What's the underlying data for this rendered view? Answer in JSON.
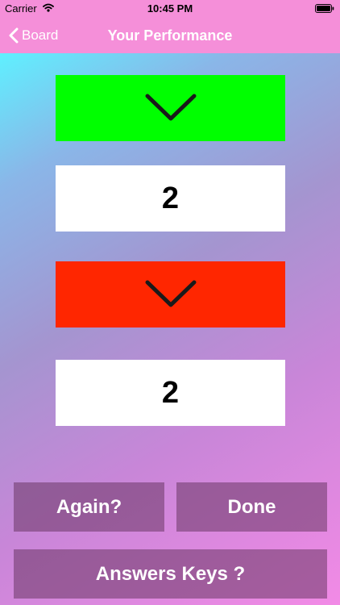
{
  "status_bar": {
    "carrier": "Carrier",
    "time": "10:45 PM",
    "wifi_icon": "wifi-icon",
    "battery_icon": "battery-icon"
  },
  "nav": {
    "back_label": "Board",
    "back_icon": "chevron-left-icon",
    "title": "Your Performance"
  },
  "results": {
    "correct_icon": "chevron-down-icon",
    "correct_color": "#00ff00",
    "correct_count": "2",
    "wrong_icon": "chevron-down-icon",
    "wrong_color": "#ff2600",
    "wrong_count": "2"
  },
  "actions": {
    "again_label": "Again?",
    "done_label": "Done",
    "answer_keys_label": "Answers Keys ?"
  },
  "colors": {
    "header_background": "#f58fd9",
    "button_background": "#6a3a66"
  }
}
